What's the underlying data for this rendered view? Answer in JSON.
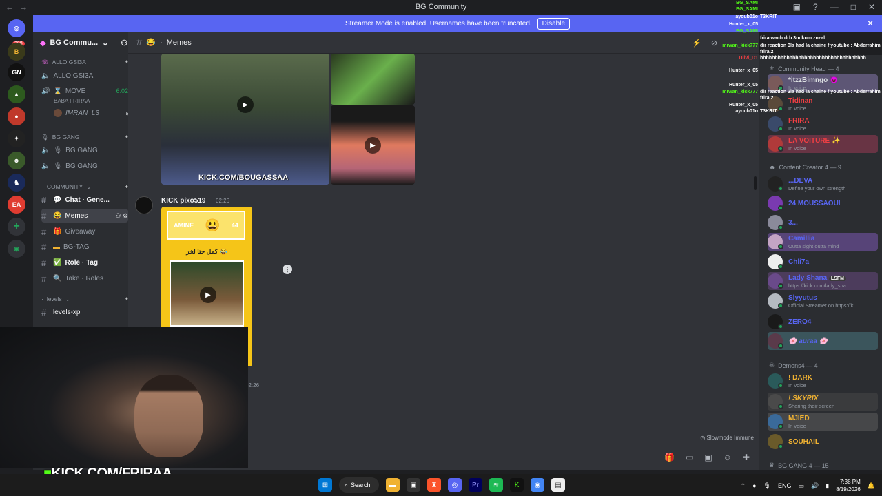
{
  "window": {
    "title": "BG Community",
    "controls": [
      "—",
      "□",
      "✕"
    ]
  },
  "banner": {
    "text": "Streamer Mode is enabled. Usernames have been truncated.",
    "disable_label": "Disable"
  },
  "servers": {
    "home_badge": "288"
  },
  "sidebar": {
    "server_name": "BG Commu...",
    "items": [
      {
        "type": "voice-cat",
        "label": "ALLO GSI3A"
      },
      {
        "type": "voice",
        "label": "ALLO GSI3A"
      },
      {
        "type": "voice",
        "label": "MOVE",
        "extra": "6:02"
      },
      {
        "type": "voice-cat",
        "label": "BG GANG"
      },
      {
        "type": "voice",
        "label": "BG GANG"
      },
      {
        "type": "voice",
        "label": "BG GANG"
      },
      {
        "type": "cat",
        "label": "COMMUNITY"
      },
      {
        "type": "text",
        "label": "Chat · Gene..."
      },
      {
        "type": "text",
        "label": "Memes"
      },
      {
        "type": "text",
        "label": "Giveaway"
      },
      {
        "type": "text",
        "label": "BG-TAG"
      },
      {
        "type": "text",
        "label": "Role · Tag"
      },
      {
        "type": "text",
        "label": "Take · Roles"
      },
      {
        "type": "cat",
        "label": "levels"
      },
      {
        "type": "text",
        "label": "levels-xp"
      }
    ],
    "voice_user_1": "BABA FRIRAA",
    "voice_user_2": "IMRAN_L3"
  },
  "channel": {
    "name": "Memes",
    "prefix": "·"
  },
  "messages": {
    "embed_caption": "KICK.COM/BOUGASSAA",
    "author": "KICK pixo519",
    "time": "02:26",
    "meme_top_left": "AMINE",
    "meme_top_right": "44",
    "meme_caption": "كمل حتا لخر 😂",
    "second_time": "02:26"
  },
  "composer": {
    "slowmode_label": "Slowmode Immune"
  },
  "members": {
    "categories": [
      {
        "label": "Community Head — 4"
      },
      {
        "label": "Content Creator 4 — 9"
      },
      {
        "label": "Demons4 — 4"
      },
      {
        "label": "BG GANG 4 — 15"
      }
    ],
    "list": [
      {
        "name": "*itzzBimngo 😈",
        "status": "In voice",
        "color": "#dbdee1"
      },
      {
        "name": "Tidinan",
        "status": "In voice",
        "color": "#f23f43"
      },
      {
        "name": "FRIRA",
        "status": "In voice",
        "color": "#f23f43"
      },
      {
        "name": "LA VOITURE ✨",
        "status": "In voice",
        "color": "#f23f43"
      },
      {
        "name": "...DEVA",
        "status": "Define your own strength",
        "color": "#5865f2"
      },
      {
        "name": "24 MOUSSAOUI",
        "status": "",
        "color": "#5865f2"
      },
      {
        "name": "3...",
        "status": "",
        "color": "#5865f2"
      },
      {
        "name": "Camillia",
        "status": "Outta sight outta mind",
        "color": "#5865f2"
      },
      {
        "name": "Chli7a",
        "status": "",
        "color": "#5865f2"
      },
      {
        "name": "Lady Shana",
        "status": "https://kick.com/lady_sha...",
        "color": "#5865f2",
        "tag": "LSFM"
      },
      {
        "name": "Slyyutus",
        "status": "Official Streamer on https://ki...",
        "color": "#5865f2"
      },
      {
        "name": "ZERO4",
        "status": "",
        "color": "#5865f2"
      },
      {
        "name": "🌸 auraa 🌸",
        "status": "",
        "color": "#5865f2"
      },
      {
        "name": "! DARK",
        "status": "In voice",
        "color": "#f0b232"
      },
      {
        "name": "! SKYRIX",
        "status": "Sharing their screen",
        "color": "#f0b232"
      },
      {
        "name": "MJIED",
        "status": "In voice",
        "color": "#f0b232"
      },
      {
        "name": "SOUHAIL",
        "status": "",
        "color": "#f0b232"
      }
    ]
  },
  "chat_overlay": [
    {
      "user": "BG_SAMI",
      "text": "",
      "color": "#53fc18"
    },
    {
      "user": "BG_SAMI",
      "text": "",
      "color": "#53fc18"
    },
    {
      "user": "ayoub01o",
      "text": "T3KRIT",
      "color": "#dbdee1"
    },
    {
      "user": "Hunter_x_05",
      "text": "",
      "color": "#dbdee1"
    },
    {
      "user": "BG_SAMI",
      "text": "",
      "color": "#53fc18"
    },
    {
      "user": "",
      "text": "frira wach drb 3ndkom znzal",
      "color": "#dbdee1"
    },
    {
      "user": "mrwan_kick777",
      "text": "dir reaction 3la had la chaine f youtube : Abderrahim frira 2",
      "color": "#53fc18"
    },
    {
      "user": "Dilvi_D1",
      "text": "hhhhhhhhhhhhhhhhhhhhhhhhhhhhhhhhhhhh",
      "color": "#f23f43"
    },
    {
      "user": "Hunter_x_05",
      "text": "",
      "color": "#dbdee1"
    },
    {
      "user": "Hunter_x_05",
      "text": "",
      "color": "#dbdee1"
    },
    {
      "user": "mrwan_kick777",
      "text": "dir reaction 3la had la chaine f youtube : Abderrahim frira 2",
      "color": "#53fc18"
    },
    {
      "user": "Hunter_x_05",
      "text": "",
      "color": "#dbdee1"
    },
    {
      "user": "ayoub01o",
      "text": "T3KRIT",
      "color": "#dbdee1"
    }
  ],
  "stream_brand": "KICK.COM/FRIRAA",
  "taskbar": {
    "search_label": "Search",
    "lang": "ENG",
    "time": "7:38 PM",
    "date": "8/19/2026"
  }
}
